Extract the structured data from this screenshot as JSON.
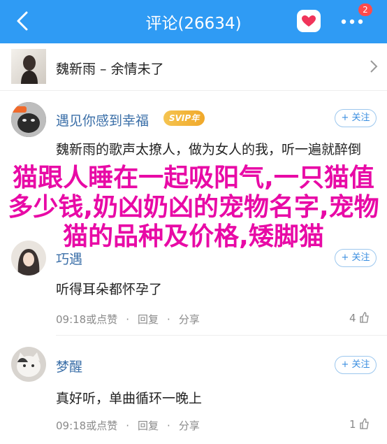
{
  "header": {
    "title": "评论(26634)",
    "badge_count": "2",
    "colors": {
      "bar": "#2f9bf4",
      "badge": "#ff4b4b"
    }
  },
  "song": {
    "text": "魏新雨 – 余情未了"
  },
  "comments": [
    {
      "name": "遇见你感到幸福",
      "vip_label": "SVIP年",
      "follow_label": "+ 关注",
      "text": "魏新雨的歌声太撩人，做为女人的我，听一遍就醉倒"
    },
    {
      "name": "巧遇",
      "follow_label": "+ 关注",
      "text": "听得耳朵都怀孕了",
      "time": "09:18或点赞",
      "reply": "回复",
      "share": "分享",
      "likes": "4"
    },
    {
      "name": "梦醒",
      "follow_label": "+ 关注",
      "text": "真好听，单曲循环一晚上",
      "time": "09:18或点赞",
      "reply": "回复",
      "share": "分享",
      "likes": "1"
    }
  ],
  "overlay": {
    "text": "猫跟人睡在一起吸阳气,一只猫值多少钱,奶凶奶凶的宠物名字,宠物猫的品种及价格,矮脚猫",
    "color": "#e80aa6"
  },
  "icons": [
    "back-arrow-icon",
    "heart-chat-icon",
    "more-icon",
    "chevron-right-icon",
    "like-thumb-icon"
  ]
}
